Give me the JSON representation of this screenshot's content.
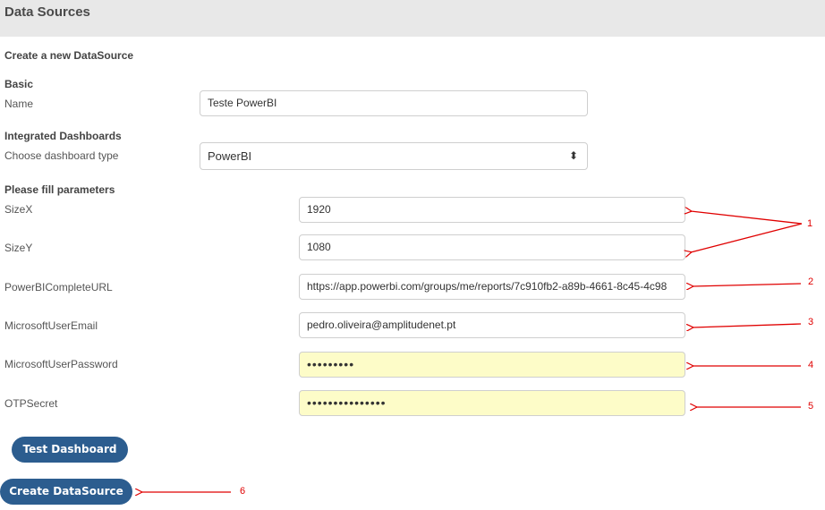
{
  "header": {
    "title": "Data Sources"
  },
  "form": {
    "subtitle": "Create a new DataSource",
    "basic_section": "Basic",
    "name_label": "Name",
    "name_value": "Teste PowerBI",
    "integrated_section": "Integrated Dashboards",
    "dashboard_type_label": "Choose dashboard type",
    "dashboard_type_value": "PowerBI",
    "params_section": "Please fill parameters",
    "params": [
      {
        "label": "SizeX",
        "value": "1920"
      },
      {
        "label": "SizeY",
        "value": "1080"
      },
      {
        "label": "PowerBICompleteURL",
        "value": "https://app.powerbi.com/groups/me/reports/7c910fb2-a89b-4661-8c45-4c98"
      },
      {
        "label": "MicrosoftUserEmail",
        "value": "pedro.oliveira@amplitudenet.pt"
      },
      {
        "label": "MicrosoftUserPassword",
        "value": "•••••••••"
      },
      {
        "label": "OTPSecret",
        "value": "•••••••••••••••"
      }
    ],
    "test_button": "Test Dashboard",
    "create_button": "Create DataSource"
  },
  "annotations": {
    "labels": [
      "1",
      "2",
      "3",
      "4",
      "5",
      "6"
    ],
    "color": "#e00000"
  },
  "colors": {
    "header_bg": "#e8e8e8",
    "button_bg": "#2c5d8f",
    "autofill_bg": "#fdfcc8"
  }
}
